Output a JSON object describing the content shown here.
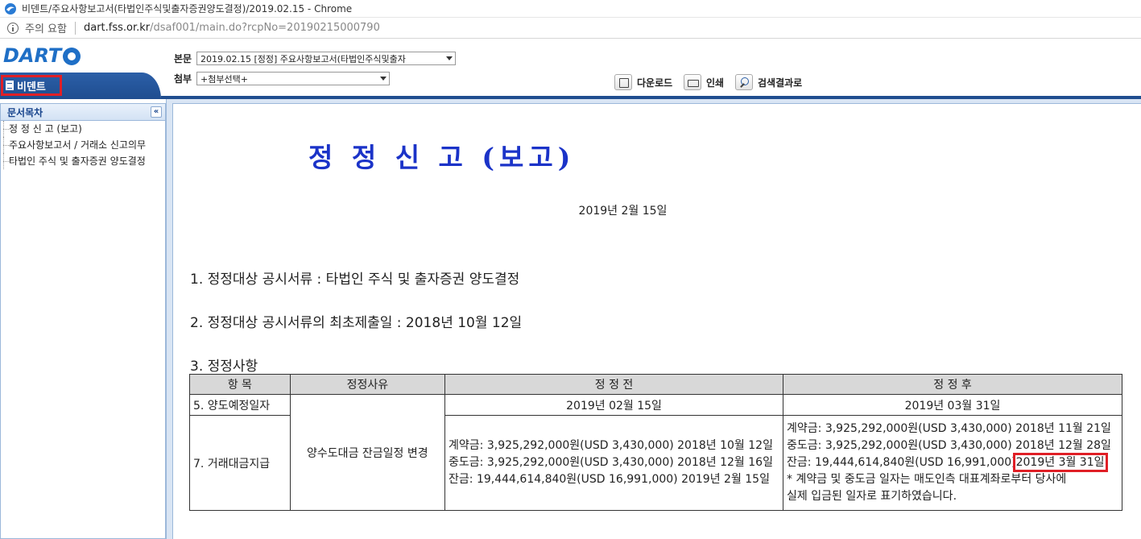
{
  "browser": {
    "title": "비덴트/주요사항보고서(타법인주식및출자증권양도결정)/2019.02.15 - Chrome",
    "security_label": "주의 요함",
    "url_host": "dart.fss.or.kr",
    "url_path": "/dsaf001/main.do?rcpNo=20190215000790"
  },
  "header": {
    "logo": "DART",
    "company_name": "비덴트",
    "main_doc_label": "본문",
    "main_doc_value": "2019.02.15  [정정] 주요사항보고서(타법인주식및출자",
    "attach_label": "첨부",
    "attach_value": "+첨부선택+",
    "buttons": {
      "download": "다운로드",
      "print": "인쇄",
      "search_results": "검색결과로"
    },
    "colors": {
      "brand": "#1f4d8f",
      "highlight": "#e01f26"
    }
  },
  "sidebar": {
    "title": "문서목차",
    "collapse": "«",
    "items": [
      {
        "label": "정 정 신 고 (보고)"
      },
      {
        "label": "주요사항보고서 / 거래소 신고의무"
      },
      {
        "label": "타법인 주식 및 출자증권 양도결정"
      }
    ]
  },
  "document": {
    "title": "정 정 신 고 (보고)",
    "date": "2019년 2월 15일",
    "line1": "1. 정정대상 공시서류 : 타법인 주식 및 출자증권 양도결정",
    "line2": "2. 정정대상 공시서류의 최초제출일 : 2018년 10월 12일",
    "line3": "3. 정정사항",
    "table": {
      "headers": [
        "항  목",
        "정정사유",
        "정 정 전",
        "정 정 후"
      ],
      "row1": {
        "item": "5. 양도예정일자",
        "reason": "양수도대금 잔금일정 변경",
        "before": "2019년 02월 15일",
        "after": "2019년 03월 31일"
      },
      "row2": {
        "item": "7. 거래대금지급",
        "before": [
          "계약금: 3,925,292,000원(USD 3,430,000) 2018년 10월 12일",
          "중도금: 3,925,292,000원(USD 3,430,000) 2018년 12월 16일",
          "잔금: 19,444,614,840원(USD 16,991,000) 2019년 2월 15일"
        ],
        "after": {
          "l1": "계약금: 3,925,292,000원(USD 3,430,000) 2018년 11월 21일",
          "l2": "중도금: 3,925,292,000원(USD 3,430,000) 2018년 12월 28일",
          "l3a": "잔금: 19,444,614,840원(USD 16,991,000)",
          "l3b": "2019년 3월 31일",
          "l4": "* 계약금 및 중도금 일자는 매도인측 대표계좌로부터 당사에",
          "l5": "실제 입금된 일자로 표기하였습니다."
        }
      }
    }
  }
}
